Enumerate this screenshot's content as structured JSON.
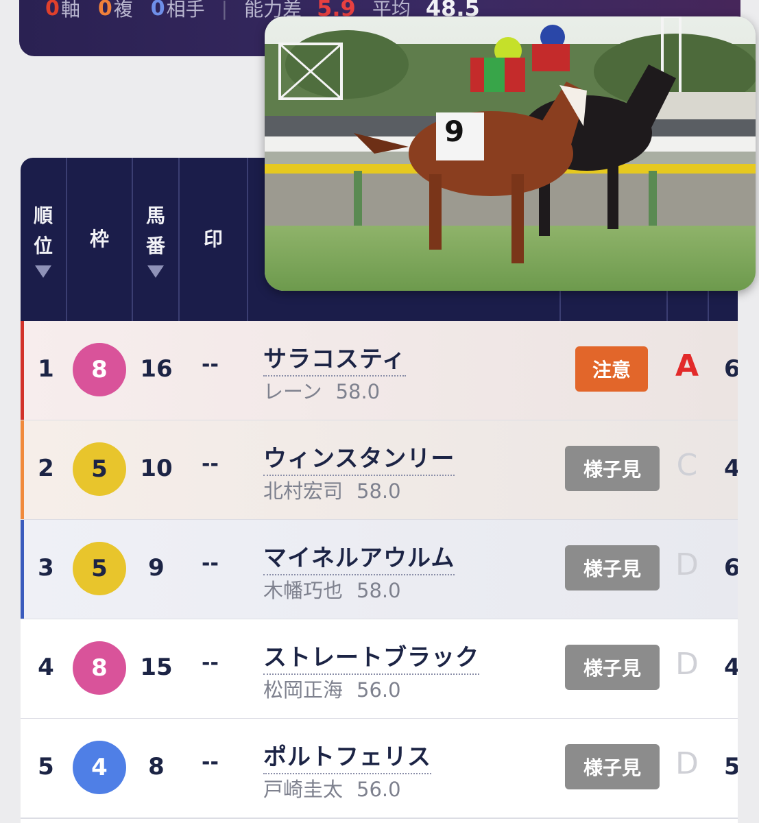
{
  "summary": {
    "jiku_count": "0",
    "jiku_label": "軸",
    "fuku_count": "0",
    "fuku_label": "複",
    "aite_count": "0",
    "aite_label": "相手",
    "separator": "|",
    "ability_diff_label": "能力差",
    "ability_diff_value": "5.9",
    "average_label": "平均",
    "average_value": "48.5"
  },
  "headers": {
    "rank": [
      "順",
      "位"
    ],
    "waku": "枠",
    "umaban": [
      "馬",
      "番"
    ],
    "mark": "印"
  },
  "colors": {
    "waku_8": "#d9539a",
    "waku_5": "#e8c52c",
    "waku_4": "#4f7fe6",
    "accent_1": "#d2322a",
    "accent_2": "#f08a3c",
    "accent_3": "#3a5bbd"
  },
  "rows": [
    {
      "rank": "1",
      "waku": "8",
      "umaban": "16",
      "mark": "--",
      "horse": "サラコスティ",
      "jockey": "レーン",
      "weight": "58.0",
      "badge": "注意",
      "grade": "A",
      "edge": "6"
    },
    {
      "rank": "2",
      "waku": "5",
      "umaban": "10",
      "mark": "--",
      "horse": "ウィンスタンリー",
      "jockey": "北村宏司",
      "weight": "58.0",
      "badge": "様子見",
      "grade": "C",
      "edge": "4"
    },
    {
      "rank": "3",
      "waku": "5",
      "umaban": "9",
      "mark": "--",
      "horse": "マイネルアウルム",
      "jockey": "木幡巧也",
      "weight": "58.0",
      "badge": "様子見",
      "grade": "D",
      "edge": "6"
    },
    {
      "rank": "4",
      "waku": "8",
      "umaban": "15",
      "mark": "--",
      "horse": "ストレートブラック",
      "jockey": "松岡正海",
      "weight": "56.0",
      "badge": "様子見",
      "grade": "D",
      "edge": "4"
    },
    {
      "rank": "5",
      "waku": "4",
      "umaban": "8",
      "mark": "--",
      "horse": "ポルトフェリス",
      "jockey": "戸崎圭太",
      "weight": "56.0",
      "badge": "様子見",
      "grade": "D",
      "edge": "5"
    }
  ],
  "video": {
    "saddle_number": "9"
  }
}
